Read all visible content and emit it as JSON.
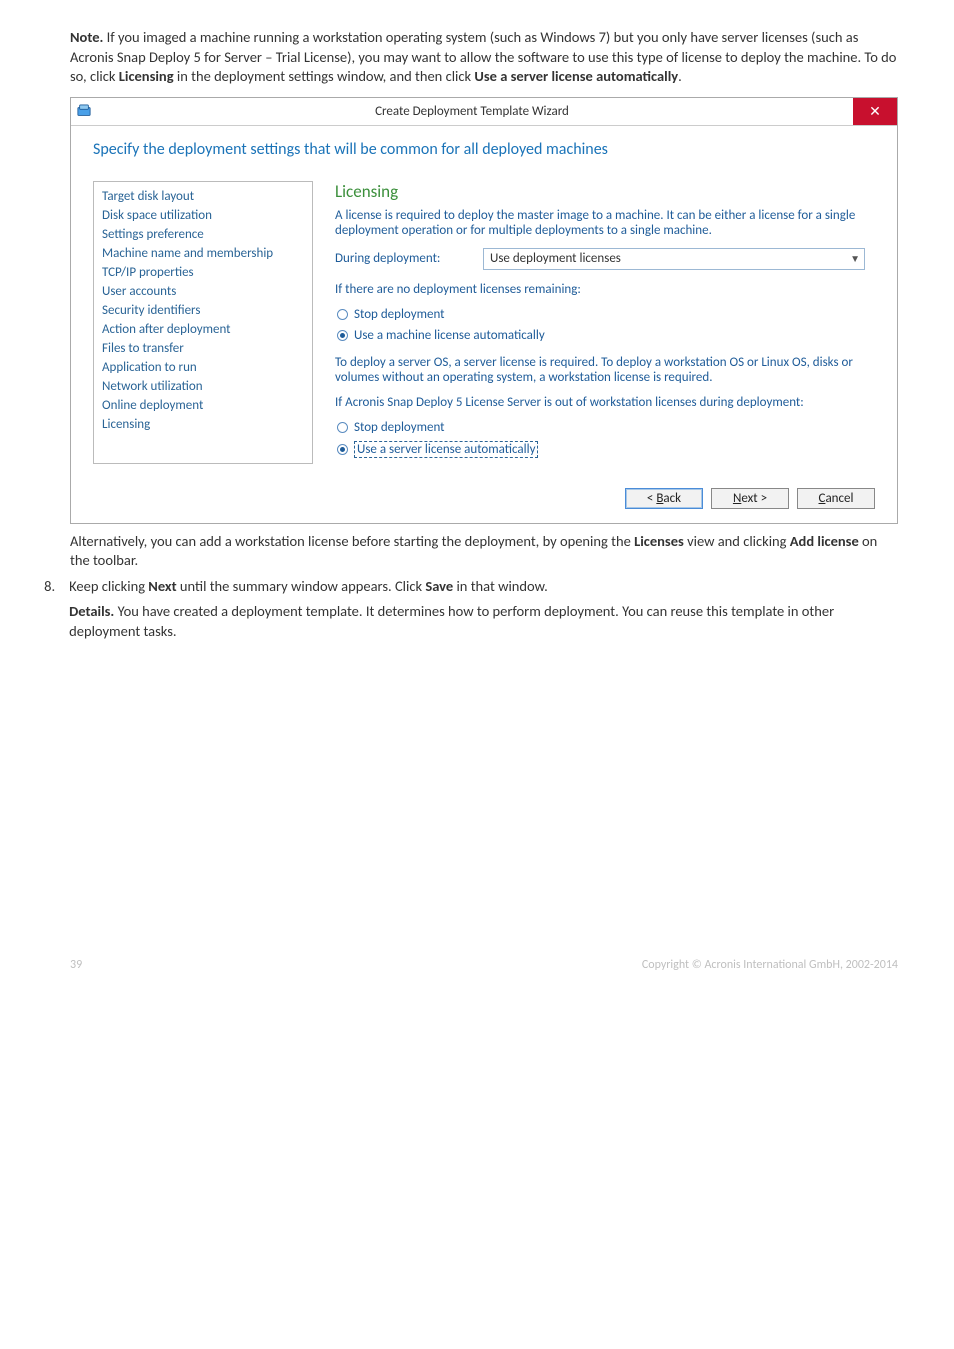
{
  "intro": {
    "note_label": "Note.",
    "note_text": " If you imaged a machine running a workstation operating system (such as Windows 7) but you only have server licenses (such as Acronis Snap Deploy 5 for Server – Trial License), you may want to allow the software to use this type of license to deploy the machine. To do so, click ",
    "licensing_word": "Licensing",
    "note_tail": " in the deployment settings window, and then click ",
    "use_server_word": "Use a server license automatically",
    "period": "."
  },
  "dialog": {
    "title": "Create Deployment Template Wizard",
    "close_glyph": "✕",
    "heading": "Specify the deployment settings that will be common for all deployed machines",
    "sidebar": {
      "items": [
        {
          "label": "Target disk layout"
        },
        {
          "label": "Disk space utilization"
        },
        {
          "label": "Settings preference"
        },
        {
          "label": "Machine name and membership"
        },
        {
          "label": "TCP/IP properties"
        },
        {
          "label": "User accounts"
        },
        {
          "label": "Security identifiers"
        },
        {
          "label": "Action after deployment"
        },
        {
          "label": "Files to transfer"
        },
        {
          "label": "Application to run"
        },
        {
          "label": "Network utilization"
        },
        {
          "label": "Online deployment"
        },
        {
          "label": "Licensing"
        }
      ]
    },
    "content": {
      "section_title": "Licensing",
      "intro": "A license is required to deploy the master image to a machine. It can be either a license for a single deployment operation or for multiple deployments to a single machine.",
      "during_label": "During deployment:",
      "during_value": "Use deployment licenses",
      "if_none": "If there are no deployment licenses remaining:",
      "stop1": "Stop deployment",
      "machine_auto": "Use a machine license automatically",
      "server_os": "To deploy a server OS, a server license is required. To deploy a workstation OS or Linux OS, disks or volumes without an operating system, a workstation license is required.",
      "if_out": "If Acronis Snap Deploy 5 License Server is out of workstation licenses during deployment:",
      "stop2": "Stop deployment",
      "server_auto": "Use a server license automatically"
    },
    "buttons": {
      "back_pre": "< ",
      "back_u": "B",
      "back_post": "ack",
      "next_u": "N",
      "next_post": "ext >",
      "cancel_u": "C",
      "cancel_post": "ancel"
    }
  },
  "after": {
    "alt_text": "Alternatively, you can add a workstation license before starting the deployment, by opening the ",
    "licenses": "Licenses",
    "alt_mid": " view and clicking ",
    "add_license": "Add license",
    "alt_end": " on the toolbar.",
    "step_num": "8.",
    "step_text_pre": "Keep clicking ",
    "next_word": "Next",
    "step_text_mid": " until the summary window appears. Click ",
    "save_word": "Save",
    "step_text_end": " in that window.",
    "details_label": "Details.",
    "details_text": " You have created a deployment template. It determines how to perform deployment. You can reuse this template in other deployment tasks."
  },
  "footer": {
    "page": "39",
    "copyright": "Copyright © Acronis International GmbH, 2002-2014"
  }
}
